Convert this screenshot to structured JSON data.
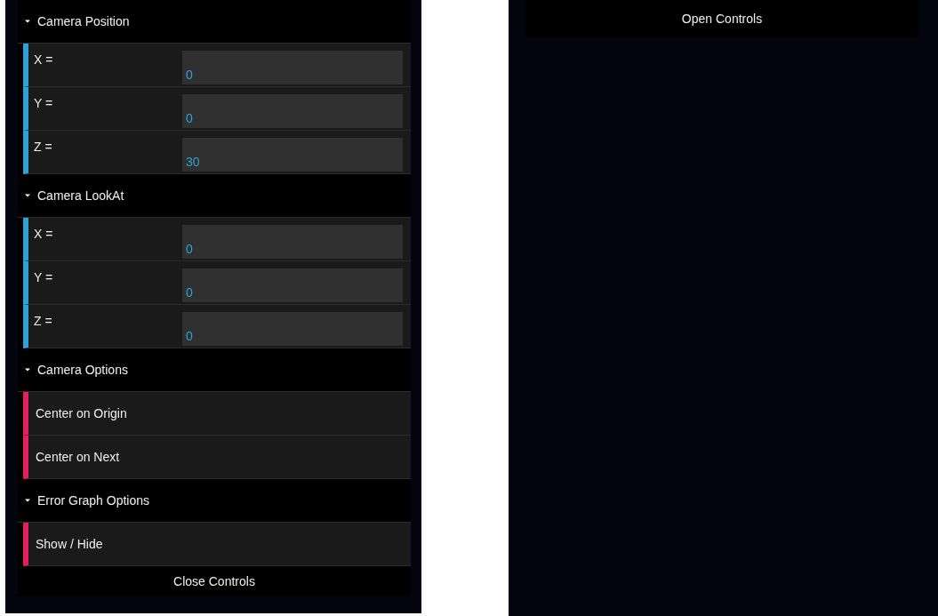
{
  "left_panel": {
    "folders": [
      {
        "title": "Camera Position",
        "expanded": true,
        "items": [
          {
            "kind": "number",
            "label": "X =",
            "value": "0"
          },
          {
            "kind": "number",
            "label": "Y =",
            "value": "0"
          },
          {
            "kind": "number",
            "label": "Z =",
            "value": "30"
          }
        ]
      },
      {
        "title": "Camera LookAt",
        "expanded": true,
        "items": [
          {
            "kind": "number",
            "label": "X =",
            "value": "0"
          },
          {
            "kind": "number",
            "label": "Y =",
            "value": "0"
          },
          {
            "kind": "number",
            "label": "Z =",
            "value": "0"
          }
        ]
      },
      {
        "title": "Camera Options",
        "expanded": true,
        "items": [
          {
            "kind": "button",
            "label": "Center on Origin"
          },
          {
            "kind": "button",
            "label": "Center on Next"
          }
        ]
      },
      {
        "title": "Error Graph Options",
        "expanded": true,
        "items": [
          {
            "kind": "button",
            "label": "Show / Hide"
          }
        ]
      }
    ],
    "close_button": "Close Controls"
  },
  "right_panel": {
    "open_button": "Open Controls"
  }
}
